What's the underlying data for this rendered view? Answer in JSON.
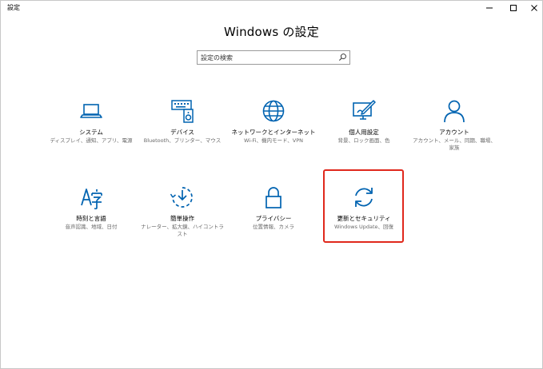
{
  "window": {
    "app_title": "設定",
    "page_title": "Windows の設定"
  },
  "search": {
    "placeholder": "設定の検索"
  },
  "tiles": [
    {
      "name": "システム",
      "desc": "ディスプレイ、通知、アプリ、電源",
      "icon": "laptop-icon"
    },
    {
      "name": "デバイス",
      "desc": "Bluetooth、プリンター、マウス",
      "icon": "devices-icon"
    },
    {
      "name": "ネットワークとインターネット",
      "desc": "Wi-Fi、機内モード、VPN",
      "icon": "globe-icon"
    },
    {
      "name": "個人用設定",
      "desc": "背景、ロック画面、色",
      "icon": "personalization-icon"
    },
    {
      "name": "アカウント",
      "desc": "アカウント、メール、同期、職場、家族",
      "icon": "person-icon"
    },
    {
      "name": "時刻と言語",
      "desc": "音声認識、地域、日付",
      "icon": "time-language-icon"
    },
    {
      "name": "簡単操作",
      "desc": "ナレーター、拡大鏡、ハイコントラスト",
      "icon": "ease-of-access-icon"
    },
    {
      "name": "プライバシー",
      "desc": "位置情報、カメラ",
      "icon": "lock-icon"
    },
    {
      "name": "更新とセキュリティ",
      "desc": "Windows Update、回復",
      "icon": "sync-icon"
    }
  ],
  "colors": {
    "accent": "#0063b1",
    "highlight": "#e0281c"
  }
}
